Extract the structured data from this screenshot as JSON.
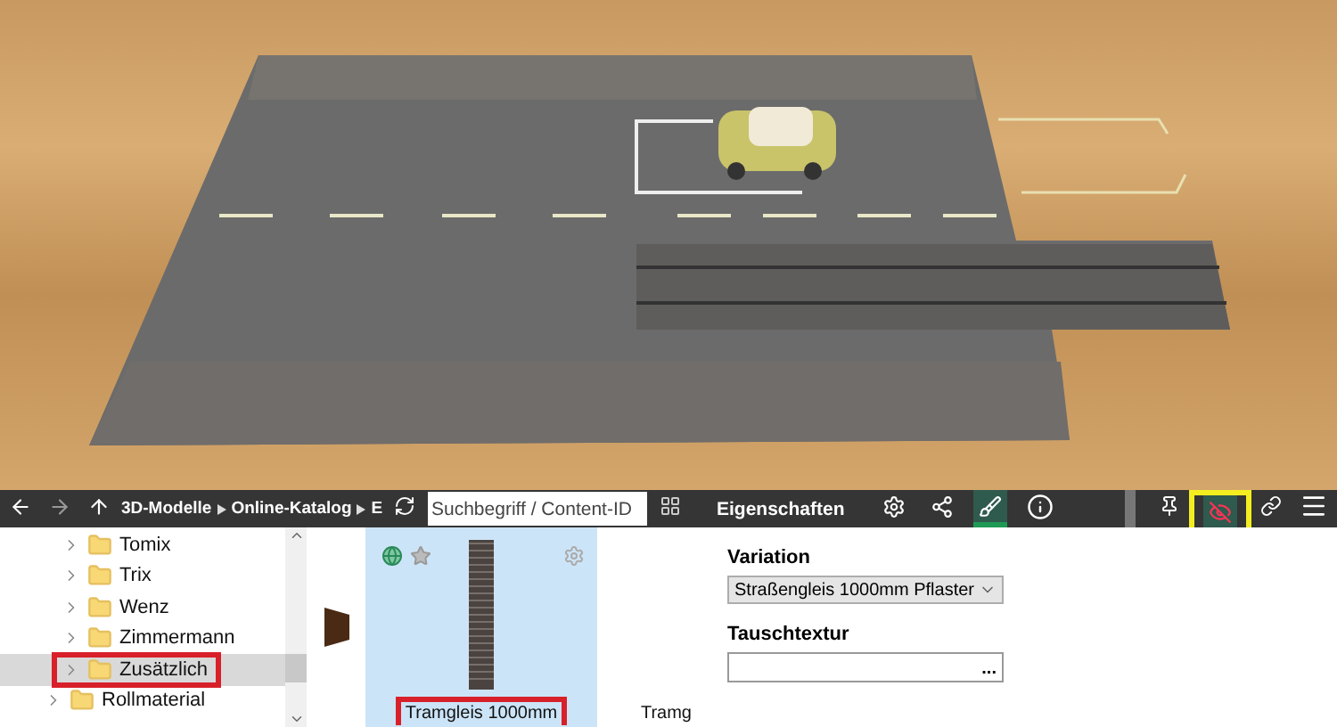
{
  "viewport": {
    "kind": "scene"
  },
  "toolbar": {
    "breadcrumb": [
      "3D-Modelle",
      "Online-Katalog",
      "E"
    ],
    "search": {
      "placeholder": "Suchbegriff / Content-ID"
    },
    "panel_title": "Eigenschaften",
    "panel_tools": [
      {
        "kind": "gear",
        "selected": false
      },
      {
        "kind": "nodes",
        "selected": false
      },
      {
        "kind": "brush",
        "selected": true
      },
      {
        "kind": "info",
        "selected": false
      }
    ],
    "view_tools": [
      {
        "kind": "pin",
        "selected": false,
        "highlighted": false
      },
      {
        "kind": "eye-off",
        "selected": true,
        "highlighted": true
      },
      {
        "kind": "link",
        "selected": false,
        "highlighted": false
      },
      {
        "kind": "menu",
        "selected": false,
        "highlighted": false
      }
    ]
  },
  "tree": {
    "nested_items": [
      {
        "label": "Tomix",
        "selected": false,
        "highlighted": false
      },
      {
        "label": "Trix",
        "selected": false,
        "highlighted": false
      },
      {
        "label": "Wenz",
        "selected": false,
        "highlighted": false
      },
      {
        "label": "Zimmermann",
        "selected": false,
        "highlighted": false
      },
      {
        "label": "Zusätzlich",
        "selected": true,
        "highlighted": true
      }
    ],
    "items": [
      {
        "label": "Rollmaterial",
        "selected": false,
        "highlighted": false
      }
    ]
  },
  "catalog": {
    "tiles": [
      {
        "label": "Tramgleis 1000mm",
        "selected": true,
        "highlighted": true
      },
      {
        "label": "Tramg",
        "selected": false,
        "highlighted": false
      }
    ]
  },
  "properties": {
    "variation": {
      "label": "Variation",
      "value": "Straßengleis 1000mm Pflaster"
    },
    "texture": {
      "label": "Tauschtextur",
      "button": "..."
    }
  }
}
